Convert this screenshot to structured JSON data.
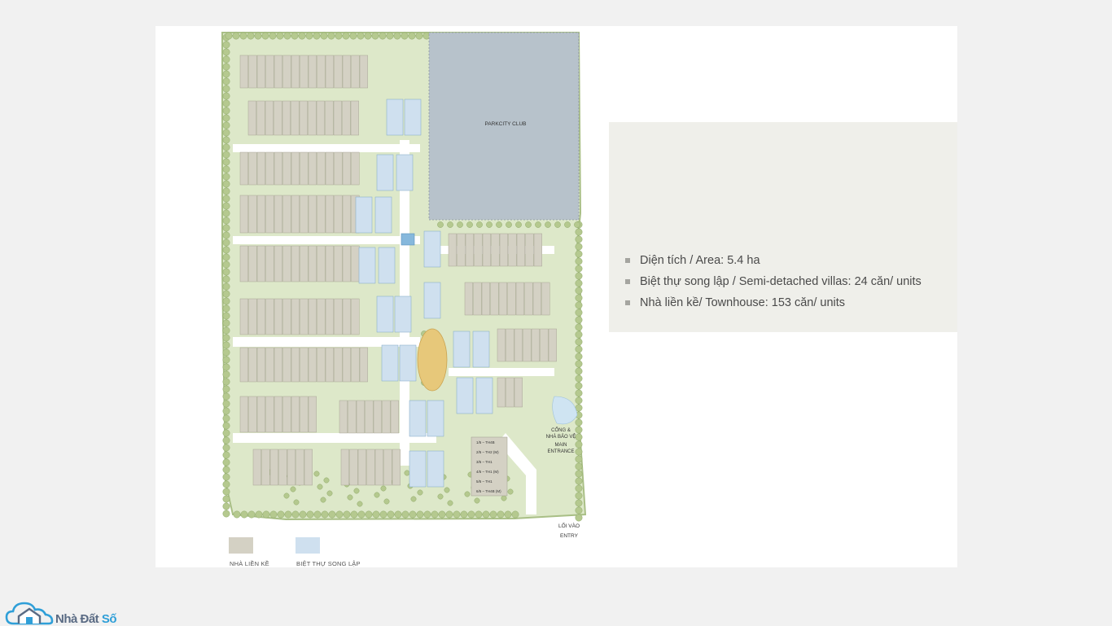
{
  "map": {
    "club_label": "PARKCITY CLUB",
    "gate_label_lines": [
      "CỔNG &",
      "NHÀ BẢO VỆ",
      "MAIN",
      "ENTRANCE"
    ],
    "entry_label_lines": [
      "LỐI VÀO",
      "ENTRY"
    ],
    "block_labels": [
      "1/5 – TH4B",
      "2/5 – TH2 (M)",
      "3/5 – TH1",
      "4/5 – TH1 (M)",
      "5/5 – TH1",
      "6/5 – TH4B (M)"
    ],
    "colors": {
      "townhouse": "#d4d1c4",
      "villa": "#cfe0ef",
      "club": "#b7c2cb",
      "greenery": "#dde8c9",
      "tree": "#b5c98f",
      "road": "#ffffff",
      "water": "#cfe4f2",
      "orange_park": "#e7c87a"
    }
  },
  "info": {
    "items": [
      "Diện tích / Area:  5.4 ha",
      "Biệt thự song lập / Semi-detached villas: 24 căn/ units",
      "Nhà liền kề/ Townhouse: 153 căn/ units"
    ]
  },
  "legend": {
    "townhouse_label": "NHÀ LIỀN KỀ",
    "villa_label": "BIỆT THỰ SONG LẬP"
  },
  "logo": {
    "text_part1": "Nhà Đất ",
    "text_part2": "Số",
    "icon": "house-cloud-icon"
  }
}
